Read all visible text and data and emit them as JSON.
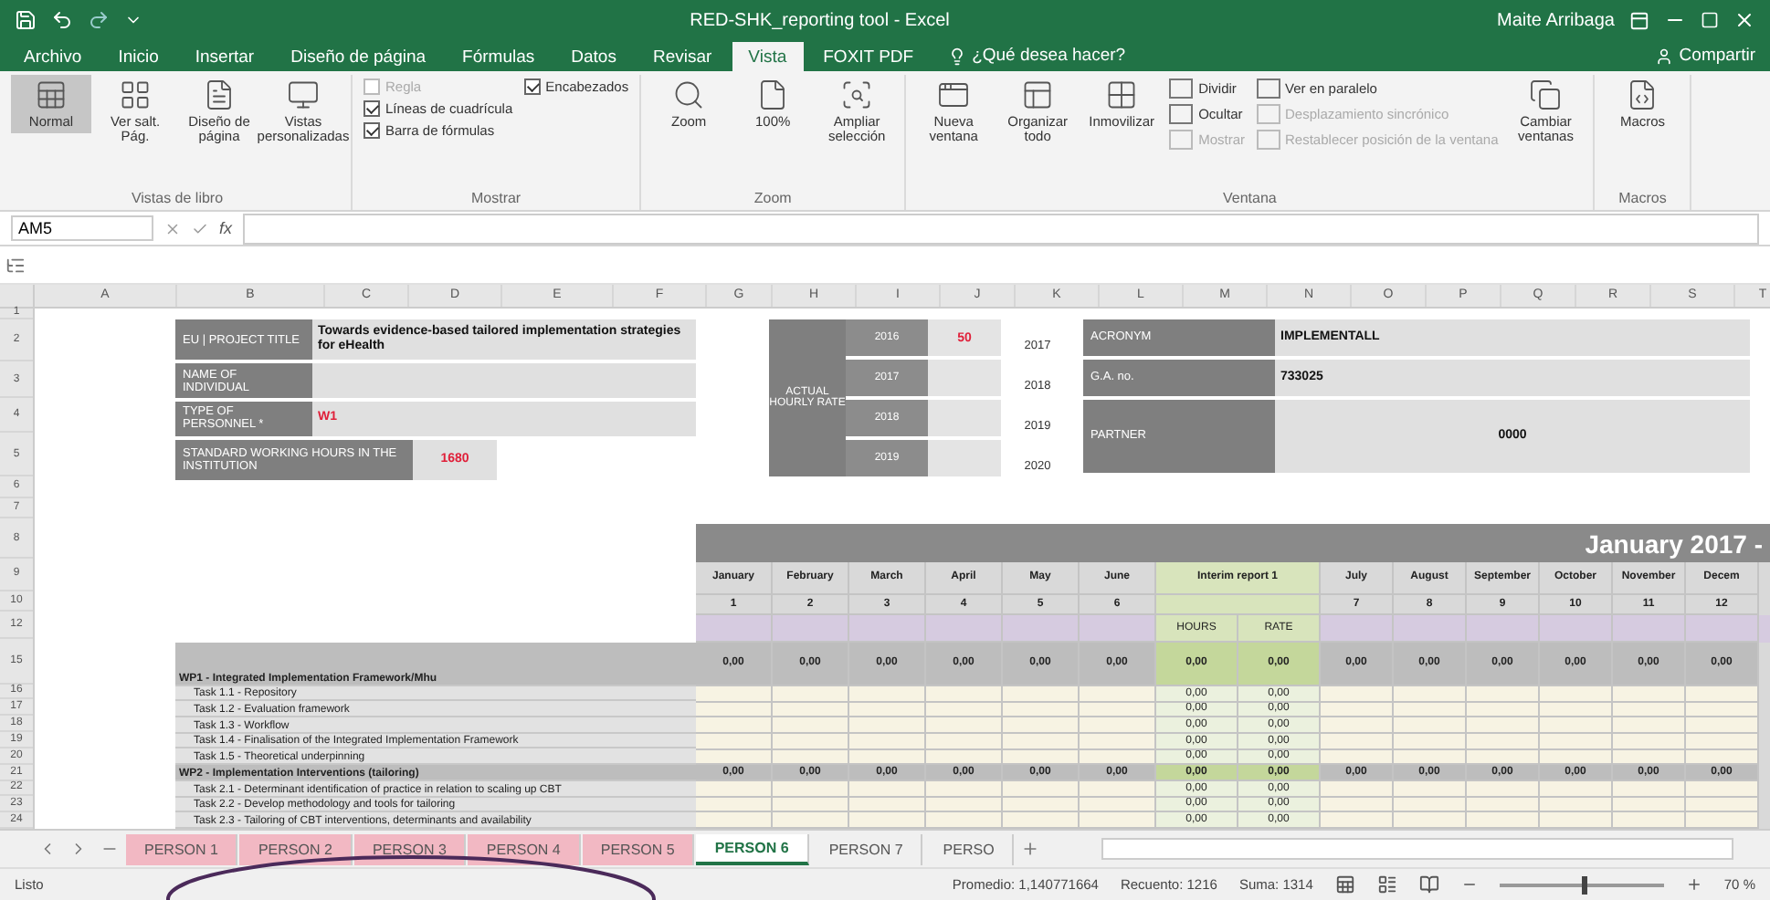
{
  "window": {
    "title": "RED-SHK_reporting tool - Excel",
    "user": "Maite Arribaga"
  },
  "ribbon_tabs": [
    {
      "label": "Archivo",
      "selected": false
    },
    {
      "label": "Inicio",
      "selected": false
    },
    {
      "label": "Insertar",
      "selected": false
    },
    {
      "label": "Diseño de página",
      "selected": false
    },
    {
      "label": "Fórmulas",
      "selected": false
    },
    {
      "label": "Datos",
      "selected": false
    },
    {
      "label": "Revisar",
      "selected": false
    },
    {
      "label": "Vista",
      "selected": true
    },
    {
      "label": "FOXIT PDF",
      "selected": false
    }
  ],
  "tell_me": "¿Qué desea hacer?",
  "share": "Compartir",
  "ribbon_groups": [
    {
      "label": "Vistas de libro",
      "items": [
        {
          "kind": "large",
          "label": "Normal",
          "selected": true
        },
        {
          "kind": "large",
          "label": "Ver salt. Pág.",
          "selected": false
        },
        {
          "kind": "large",
          "label": "Diseño de página",
          "selected": false
        },
        {
          "kind": "large",
          "label": "Vistas personalizadas",
          "selected": false
        }
      ]
    },
    {
      "label": "Mostrar",
      "items": [
        {
          "kind": "check",
          "label": "Regla",
          "checked": false,
          "disabled": true
        },
        {
          "kind": "check",
          "label": "Líneas de cuadrícula",
          "checked": true,
          "disabled": false
        },
        {
          "kind": "check",
          "label": "Barra de fórmulas",
          "checked": true,
          "disabled": false
        },
        {
          "kind": "check",
          "label": "Encabezados",
          "checked": true,
          "disabled": false
        }
      ]
    },
    {
      "label": "Zoom",
      "items": [
        {
          "kind": "large",
          "label": "Zoom"
        },
        {
          "kind": "large",
          "label": "100%"
        },
        {
          "kind": "large",
          "label": "Ampliar selección"
        }
      ]
    },
    {
      "label": "Ventana",
      "items": [
        {
          "kind": "large",
          "label": "Nueva ventana"
        },
        {
          "kind": "large",
          "label": "Organizar todo"
        },
        {
          "kind": "large",
          "label": "Inmovilizar"
        },
        {
          "kind": "small",
          "label": "Dividir",
          "disabled": false
        },
        {
          "kind": "small",
          "label": "Ocultar",
          "disabled": false
        },
        {
          "kind": "small",
          "label": "Mostrar",
          "disabled": true
        },
        {
          "kind": "small",
          "label": "Ver en paralelo",
          "disabled": false
        },
        {
          "kind": "small",
          "label": "Desplazamiento sincrónico",
          "disabled": true
        },
        {
          "kind": "small",
          "label": "Restablecer posición de la ventana",
          "disabled": true
        },
        {
          "kind": "large",
          "label": "Cambiar ventanas"
        }
      ]
    },
    {
      "label": "Macros",
      "items": [
        {
          "kind": "large",
          "label": "Macros"
        }
      ]
    }
  ],
  "formula_bar": {
    "name_box": "AM5",
    "function_label": "fx"
  },
  "columns": [
    "A",
    "B",
    "C",
    "D",
    "E",
    "F",
    "G",
    "H",
    "I",
    "J",
    "K",
    "L",
    "M",
    "N",
    "O",
    "P",
    "Q",
    "R",
    "S",
    "T"
  ],
  "rows": [
    "1",
    "2",
    "3",
    "4",
    "5",
    "6",
    "7",
    "8",
    "9",
    "10",
    "12",
    "15",
    "16",
    "17",
    "18",
    "19",
    "20",
    "21",
    "22",
    "23",
    "24"
  ],
  "project": [
    {
      "label": "EU | PROJECT TITLE",
      "value": "Towards evidence-based tailored implementation strategies for eHealth",
      "kind": "text"
    },
    {
      "label": "NAME OF INDIVIDUAL",
      "kind": "text"
    },
    {
      "label": "TYPE OF PERSONNEL *",
      "value": "W1",
      "kind": "alert"
    },
    {
      "label": "STANDARD WORKING HOURS IN THE INSTITUTION",
      "value": "1680",
      "kind": "alert"
    }
  ],
  "rates": {
    "title": "ACTUAL HOURLY RATE",
    "rows": [
      {
        "label": "2016",
        "value": "50",
        "year": "2017"
      },
      {
        "label": "2017",
        "year": "2018"
      },
      {
        "label": "2018",
        "year": "2019"
      },
      {
        "label": "2019",
        "year": "2020"
      }
    ]
  },
  "project_info": [
    {
      "label": "ACRONYM",
      "value": "IMPLEMENTALL"
    },
    {
      "label": "G.A. no.",
      "value": "733025"
    },
    {
      "label": "PARTNER",
      "value": "0000"
    }
  ],
  "timesheet": {
    "banner": "January 2017 -",
    "months": [
      {
        "name": "January",
        "number": "1",
        "kind": "month"
      },
      {
        "name": "February",
        "number": "2",
        "kind": "month"
      },
      {
        "name": "March",
        "number": "3",
        "kind": "month"
      },
      {
        "name": "April",
        "number": "4",
        "kind": "month"
      },
      {
        "name": "May",
        "number": "5",
        "kind": "month"
      },
      {
        "name": "June",
        "number": "6",
        "kind": "month"
      },
      {
        "name": "Interim report 1",
        "kind": "interim"
      },
      {
        "name": "July",
        "number": "7",
        "kind": "month"
      },
      {
        "name": "August",
        "number": "8",
        "kind": "month"
      },
      {
        "name": "September",
        "number": "9",
        "kind": "month"
      },
      {
        "name": "October",
        "number": "10",
        "kind": "month"
      },
      {
        "name": "November",
        "number": "11",
        "kind": "month"
      },
      {
        "name": "Decem",
        "number": "12",
        "kind": "month"
      }
    ],
    "subheaders": [
      "HOURS",
      "RATE"
    ],
    "rows": [
      {
        "kind": "wp",
        "label": "WP1 - Integrated Implementation Framework/Mhu",
        "months": [
          "0,00",
          "0,00",
          "0,00",
          "0,00",
          "0,00",
          "0,00",
          "0,00",
          "0,00",
          "0,00",
          "0,00",
          "0,00",
          "0,00"
        ],
        "interim": [
          "0,00",
          "0,00"
        ]
      },
      {
        "kind": "task",
        "label": "Task 1.1 - Repository",
        "interim": [
          "0,00",
          "0,00"
        ]
      },
      {
        "kind": "task",
        "label": "Task 1.2 - Evaluation framework",
        "interim": [
          "0,00",
          "0,00"
        ]
      },
      {
        "kind": "task",
        "label": "Task 1.3 - Workflow",
        "interim": [
          "0,00",
          "0,00"
        ]
      },
      {
        "kind": "task",
        "label": "Task 1.4 - Finalisation of the Integrated Implementation Framework",
        "interim": [
          "0,00",
          "0,00"
        ]
      },
      {
        "kind": "task",
        "label": "Task 1.5 - Theoretical underpinning",
        "interim": [
          "0,00",
          "0,00"
        ]
      },
      {
        "kind": "wp",
        "label": "WP2 - Implementation Interventions (tailoring)",
        "months": [
          "0,00",
          "0,00",
          "0,00",
          "0,00",
          "0,00",
          "0,00",
          "0,00",
          "0,00",
          "0,00",
          "0,00",
          "0,00",
          "0,00"
        ],
        "interim": [
          "0,00",
          "0,00"
        ]
      },
      {
        "kind": "task",
        "label": "Task 2.1 - Determinant identification of practice in relation to scaling up CBT",
        "interim": [
          "0,00",
          "0,00"
        ]
      },
      {
        "kind": "task",
        "label": "Task 2.2 - Develop methodology and tools for tailoring",
        "interim": [
          "0,00",
          "0,00"
        ]
      },
      {
        "kind": "task",
        "label": "Task 2.3 - Tailoring of CBT interventions, determinants and availability",
        "interim": [
          "0,00",
          "0,00"
        ]
      }
    ]
  },
  "sheet_tabs": [
    {
      "label": "PERSON 1",
      "selected": false,
      "color": "#f2b8c3"
    },
    {
      "label": "PERSON 2",
      "selected": false,
      "color": "#f2b8c3"
    },
    {
      "label": "PERSON 3",
      "selected": false,
      "color": "#f2b8c3"
    },
    {
      "label": "PERSON 4",
      "selected": false,
      "color": "#f2b8c3"
    },
    {
      "label": "PERSON 5",
      "selected": false,
      "color": "#f2b8c3"
    },
    {
      "label": "PERSON 6",
      "selected": true
    },
    {
      "label": "PERSON 7",
      "selected": false
    },
    {
      "label": "PERSO",
      "selected": false
    }
  ],
  "status_bar": {
    "mode": "Listo",
    "stats": [
      "Promedio: 1,140771664",
      "Recuento: 1216",
      "Suma: 1314"
    ],
    "zoom": {
      "level": 0.5,
      "reading": "70 %"
    }
  }
}
